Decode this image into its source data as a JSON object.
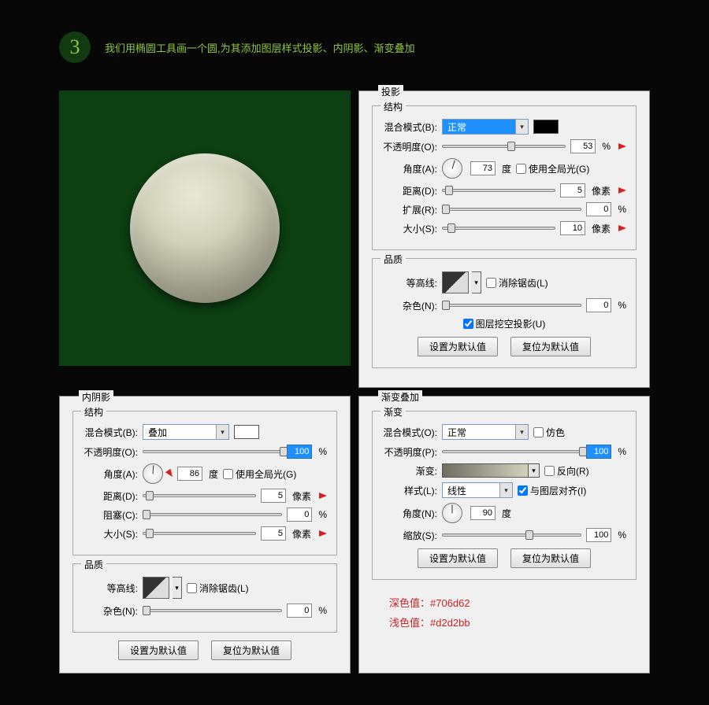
{
  "step": {
    "num": "3",
    "text": "我们用椭圆工具画一个圆,为其添加图层样式投影、内阴影、渐变叠加"
  },
  "dropShadow": {
    "title": "投影",
    "structure_legend": "结构",
    "quality_legend": "品质",
    "blend_label": "混合模式(B):",
    "blend_value": "正常",
    "opacity_label": "不透明度(O):",
    "opacity_value": "53",
    "opacity_unit": "%",
    "angle_label": "角度(A):",
    "angle_value": "73",
    "angle_unit": "度",
    "global_light": "使用全局光(G)",
    "distance_label": "距离(D):",
    "distance_value": "5",
    "distance_unit": "像素",
    "spread_label": "扩展(R):",
    "spread_value": "0",
    "spread_unit": "%",
    "size_label": "大小(S):",
    "size_value": "10",
    "size_unit": "像素",
    "contour_label": "等高线:",
    "antialias": "消除锯齿(L)",
    "noise_label": "杂色(N):",
    "noise_value": "0",
    "noise_unit": "%",
    "knockout": "图层挖空投影(U)",
    "btn_default": "设置为默认值",
    "btn_reset": "复位为默认值"
  },
  "innerShadow": {
    "title": "内阴影",
    "structure_legend": "结构",
    "quality_legend": "品质",
    "blend_label": "混合模式(B):",
    "blend_value": "叠加",
    "opacity_label": "不透明度(O):",
    "opacity_value": "100",
    "opacity_unit": "%",
    "angle_label": "角度(A):",
    "angle_value": "86",
    "angle_unit": "度",
    "global_light": "使用全局光(G)",
    "distance_label": "距离(D):",
    "distance_value": "5",
    "distance_unit": "像素",
    "choke_label": "阻塞(C):",
    "choke_value": "0",
    "choke_unit": "%",
    "size_label": "大小(S):",
    "size_value": "5",
    "size_unit": "像素",
    "contour_label": "等高线:",
    "antialias": "消除锯齿(L)",
    "noise_label": "杂色(N):",
    "noise_value": "0",
    "noise_unit": "%",
    "btn_default": "设置为默认值",
    "btn_reset": "复位为默认值"
  },
  "gradient": {
    "title": "渐变叠加",
    "legend": "渐变",
    "blend_label": "混合模式(O):",
    "blend_value": "正常",
    "dither": "仿色",
    "opacity_label": "不透明度(P):",
    "opacity_value": "100",
    "opacity_unit": "%",
    "gradient_label": "渐变:",
    "reverse": "反向(R)",
    "style_label": "样式(L):",
    "style_value": "线性",
    "align": "与图层对齐(I)",
    "angle_label": "角度(N):",
    "angle_value": "90",
    "angle_unit": "度",
    "scale_label": "缩放(S):",
    "scale_value": "100",
    "scale_unit": "%",
    "btn_default": "设置为默认值",
    "btn_reset": "复位为默认值",
    "note1_label": "深色值：",
    "note1_value": "#706d62",
    "note2_label": "浅色值：",
    "note2_value": "#d2d2bb"
  }
}
